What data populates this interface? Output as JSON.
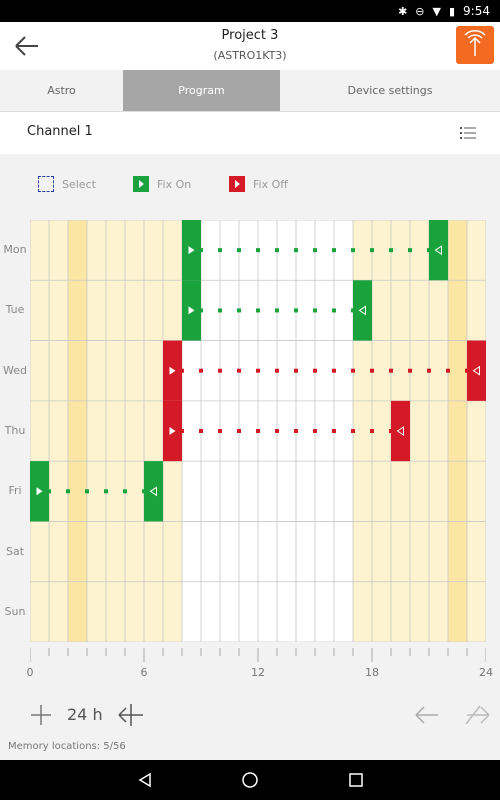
{
  "status": {
    "time": "9:54"
  },
  "header": {
    "title": "Project 3",
    "subtitle": "(ASTRO1KT3)"
  },
  "tabs": [
    {
      "label": "Astro",
      "active": false
    },
    {
      "label": "Program",
      "active": true
    },
    {
      "label": "Device settings",
      "active": false
    }
  ],
  "channel": {
    "label": "Channel 1"
  },
  "legend": {
    "select": "Select",
    "fix_on": "Fix On",
    "fix_off": "Fix Off"
  },
  "days": [
    "Mon",
    "Tue",
    "Wed",
    "Thu",
    "Fri",
    "Sat",
    "Sun"
  ],
  "hours_per_day": 24,
  "x_tick_labels": [
    "0",
    "6",
    "12",
    "18",
    "24"
  ],
  "schedule": [
    {
      "day": "Mon",
      "type": "fix_on",
      "start": 8,
      "end": 21
    },
    {
      "day": "Tue",
      "type": "fix_on",
      "start": 8,
      "end": 17
    },
    {
      "day": "Wed",
      "type": "fix_off",
      "start": 7,
      "end": 23
    },
    {
      "day": "Thu",
      "type": "fix_off",
      "start": 7,
      "end": 19
    },
    {
      "day": "Fri",
      "type": "fix_on",
      "start": 0,
      "end": 6
    }
  ],
  "zoom": {
    "label": "24 h"
  },
  "memory": {
    "text": "Memory locations: 5/56"
  },
  "colors": {
    "fix_on": "#1aa33c",
    "fix_off": "#d51a27",
    "accent": "#f26b21",
    "night_light": "#fdf3d0",
    "night_dark": "#fbe6a3",
    "day": "#ffffff",
    "grid_line": "#c8c8c8"
  },
  "icons": {
    "back": "back-arrow-icon",
    "action": "antenna-upload-icon",
    "list": "list-icon",
    "zoom_in": "plus-icon",
    "zoom_out": "collapse-arrows-icon",
    "undo": "undo-arrow-icon",
    "redo": "redo-arrow-icon"
  }
}
